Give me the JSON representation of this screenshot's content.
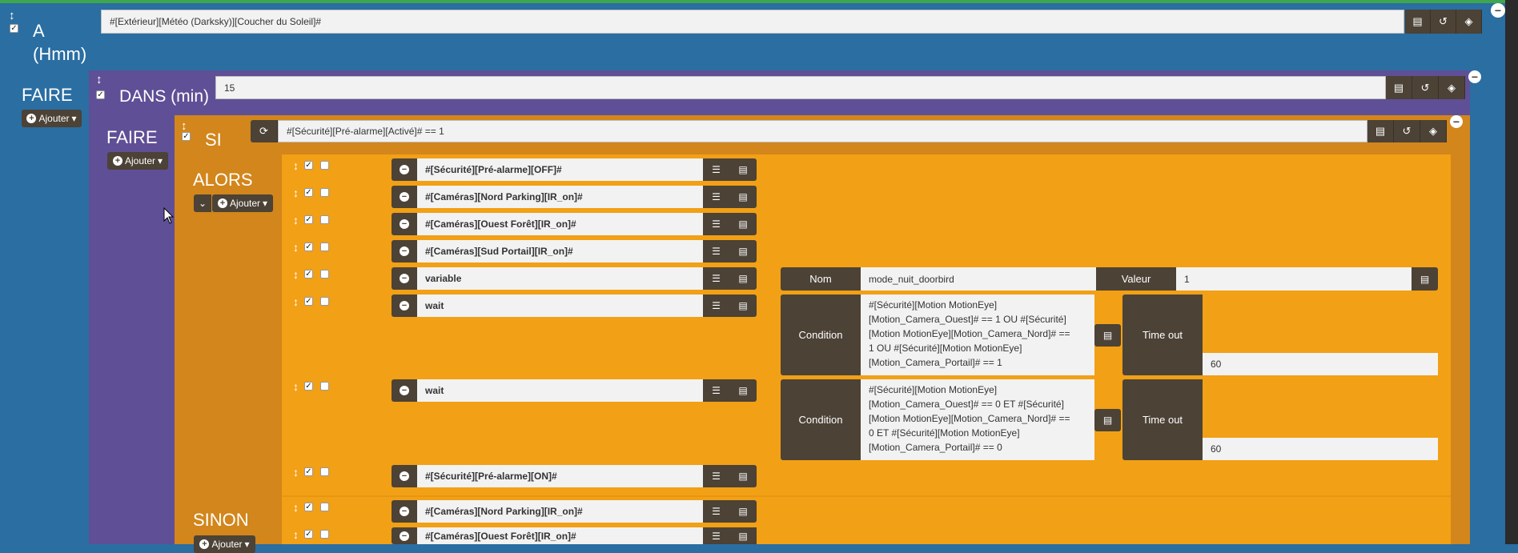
{
  "block_a": {
    "title": "A",
    "subtitle": "(Hmm)",
    "expression": "#[Extérieur][Météo (Darksky)][Coucher du Soleil]#"
  },
  "faire_1": {
    "label": "FAIRE",
    "add_label": "Ajouter"
  },
  "dans": {
    "label": "DANS (min)",
    "value": "15"
  },
  "faire_2": {
    "label": "FAIRE",
    "add_label": "Ajouter"
  },
  "si": {
    "label": "SI",
    "condition": "#[Sécurité][Pré-alarme][Activé]# == 1"
  },
  "alors": {
    "label": "ALORS",
    "add_label": "Ajouter",
    "actions": [
      {
        "text": "#[Sécurité][Pré-alarme][OFF]#"
      },
      {
        "text": "#[Caméras][Nord Parking][IR_on]#"
      },
      {
        "text": "#[Caméras][Ouest Forêt][IR_on]#"
      },
      {
        "text": "#[Caméras][Sud Portail][IR_on]#"
      },
      {
        "text": "variable"
      },
      {
        "text": "wait"
      },
      {
        "text": "wait"
      },
      {
        "text": "#[Sécurité][Pré-alarme][ON]#"
      }
    ],
    "variable": {
      "nom_label": "Nom",
      "nom_value": "mode_nuit_doorbird",
      "valeur_label": "Valeur",
      "valeur_value": "1"
    },
    "wait1": {
      "condition_label": "Condition",
      "condition_lines": [
        "#[Sécurité][Motion MotionEye]",
        "[Motion_Camera_Ouest]# == 1 OU #[Sécurité]",
        "[Motion MotionEye][Motion_Camera_Nord]# ==",
        "1 OU #[Sécurité][Motion MotionEye]",
        "[Motion_Camera_Portail]# == 1"
      ],
      "timeout_label": "Time out",
      "timeout_value": "60"
    },
    "wait2": {
      "condition_label": "Condition",
      "condition_lines": [
        "#[Sécurité][Motion MotionEye]",
        "[Motion_Camera_Ouest]# == 0 ET #[Sécurité]",
        "[Motion MotionEye][Motion_Camera_Nord]# ==",
        "0 ET #[Sécurité][Motion MotionEye]",
        "[Motion_Camera_Portail]# == 0"
      ],
      "timeout_label": "Time out",
      "timeout_value": "60"
    }
  },
  "sinon": {
    "label": "SINON",
    "add_label": "Ajouter",
    "actions": [
      {
        "text": "#[Caméras][Nord Parking][IR_on]#"
      },
      {
        "text": "#[Caméras][Ouest Forêt][IR_on]#"
      }
    ]
  },
  "icons": {
    "move": "↕",
    "check": "✓",
    "list": "≡",
    "history": "↺",
    "cube": "◈",
    "refresh": "⟳",
    "minus": "−",
    "plus": "+",
    "caret": "▾",
    "chevron": "⌄",
    "options": "☰",
    "form": "▤"
  },
  "colors": {
    "blue": "#2a6ea2",
    "purple": "#5f4f96",
    "orange": "#f2a015",
    "orange_dark": "#d2861b",
    "button": "#4c4236"
  }
}
